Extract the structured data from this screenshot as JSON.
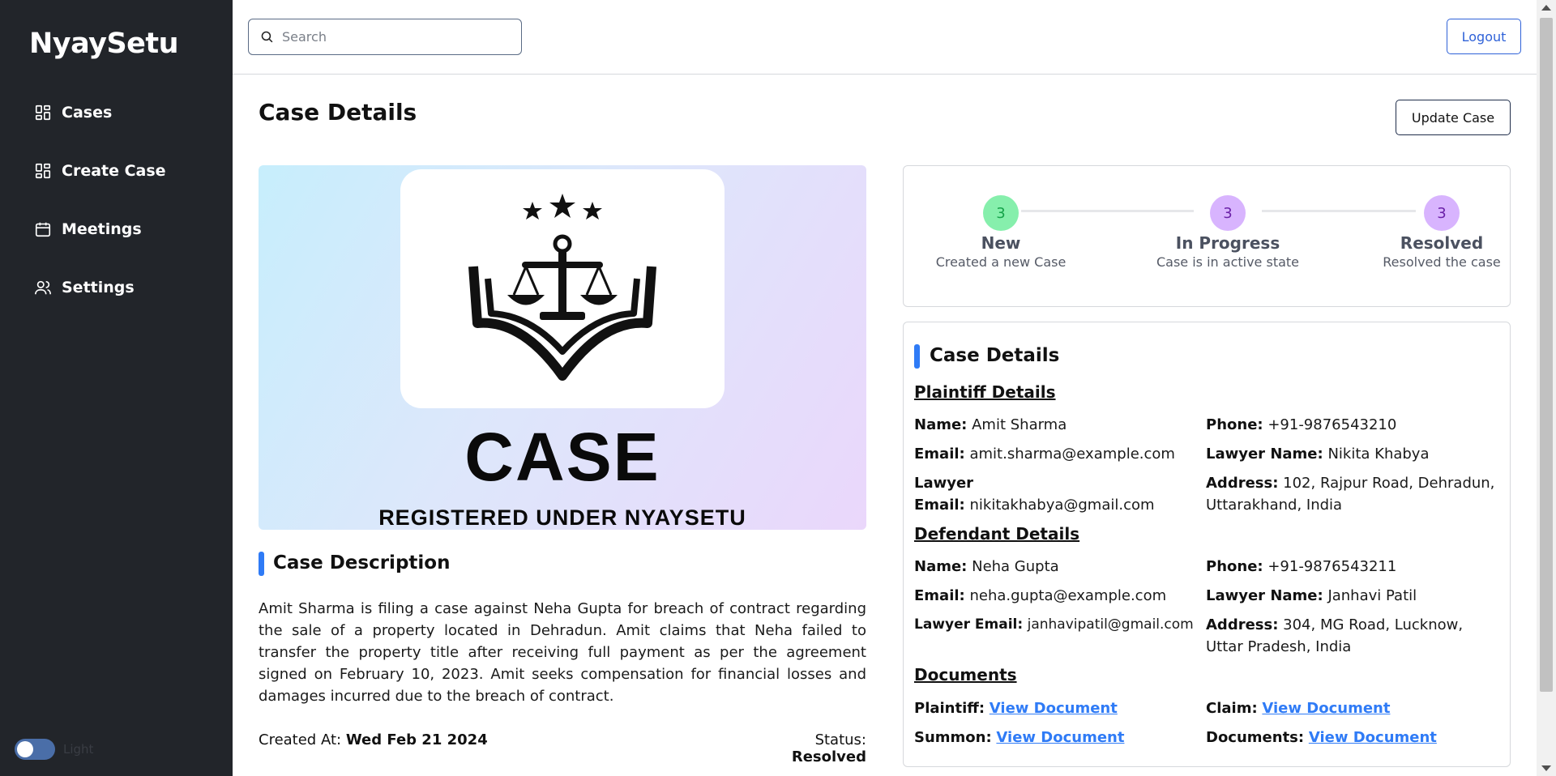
{
  "app": {
    "brand": "NyaySetu"
  },
  "sidebar": {
    "items": [
      {
        "label": "Cases",
        "icon": "grid-icon"
      },
      {
        "label": "Create Case",
        "icon": "grid-icon"
      },
      {
        "label": "Meetings",
        "icon": "calendar-icon"
      },
      {
        "label": "Settings",
        "icon": "users-icon"
      }
    ],
    "theme_toggle": {
      "label": "Light",
      "on": false
    }
  },
  "topbar": {
    "search_placeholder": "Search",
    "logout_label": "Logout"
  },
  "page": {
    "title": "Case Details",
    "update_label": "Update Case"
  },
  "hero": {
    "case_text": "CASE",
    "registered_text": "REGISTERED UNDER NYAYSETU"
  },
  "description": {
    "title": "Case Description",
    "text": "Amit Sharma is filing a case against Neha Gupta for breach of contract regarding the sale of a property located in Dehradun. Amit claims that Neha failed to transfer the property title after receiving full payment as per the agreement signed on February 10, 2023. Amit seeks compensation for financial losses and damages incurred due to the breach of contract.",
    "created_label": "Created At:",
    "created_value": "Wed Feb 21 2024",
    "status_label": "Status:",
    "status_value": "Resolved"
  },
  "steps": [
    {
      "num": "3",
      "label": "New",
      "sub": "Created a new Case",
      "color": "#86efac",
      "text_color": "#16a34a"
    },
    {
      "num": "3",
      "label": "In Progress",
      "sub": "Case is in active state",
      "color": "#d8b4fe",
      "text_color": "#6b21a8"
    },
    {
      "num": "3",
      "label": "Resolved",
      "sub": "Resolved the case",
      "color": "#d8b4fe",
      "text_color": "#6b21a8"
    }
  ],
  "details": {
    "title": "Case Details",
    "plaintiff": {
      "heading": "Plaintiff Details",
      "name_label": "Name:",
      "name": "Amit Sharma",
      "phone_label": "Phone:",
      "phone": "+91-9876543210",
      "email_label": "Email:",
      "email": "amit.sharma@example.com",
      "lawyer_name_label": "Lawyer Name:",
      "lawyer_name": "Nikita Khabya",
      "lawyer_email_label_1": "Lawyer",
      "lawyer_email_label_2": "Email:",
      "lawyer_email": "nikitakhabya@gmail.com",
      "address_label": "Address:",
      "address": "102, Rajpur Road, Dehradun, Uttarakhand, India"
    },
    "defendant": {
      "heading": "Defendant Details",
      "name_label": "Name:",
      "name": "Neha Gupta",
      "phone_label": "Phone:",
      "phone": "+91-9876543211",
      "email_label": "Email:",
      "email": "neha.gupta@example.com",
      "lawyer_name_label": "Lawyer Name:",
      "lawyer_name": "Janhavi Patil",
      "lawyer_email_label": "Lawyer Email:",
      "lawyer_email": "janhavipatil@gmail.com",
      "address_label": "Address:",
      "address": "304, MG Road, Lucknow, Uttar Pradesh, India"
    },
    "documents": {
      "heading": "Documents",
      "plaintiff_label": "Plaintiff:",
      "claim_label": "Claim:",
      "summon_label": "Summon:",
      "documents_label": "Documents:",
      "link_text": "View Document"
    }
  }
}
